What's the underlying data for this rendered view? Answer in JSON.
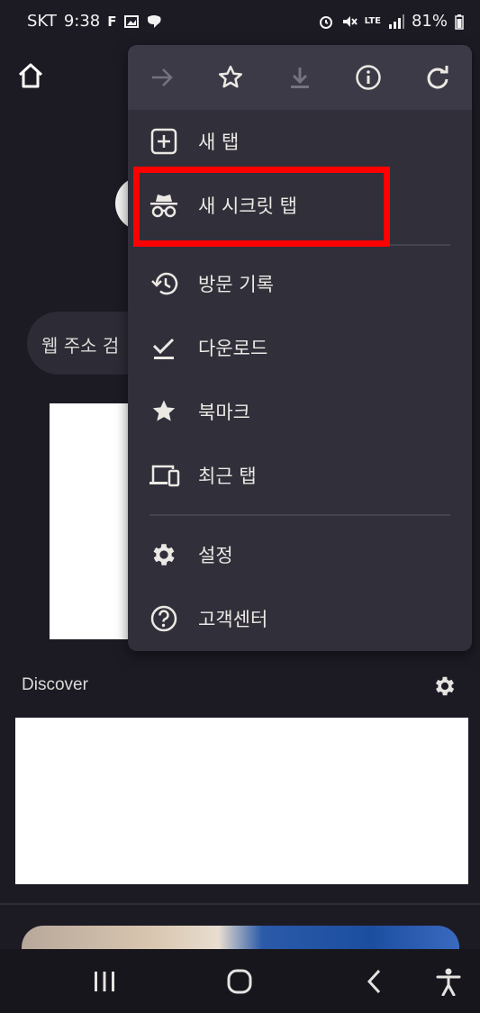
{
  "status_bar": {
    "carrier": "SKT",
    "time": "9:38",
    "network": "LTE",
    "battery": "81%"
  },
  "page": {
    "search_placeholder": "웹 주소 검",
    "discover_label": "Discover"
  },
  "menu": {
    "toolbar_icons": [
      "forward-icon",
      "bookmark-star-icon",
      "download-icon",
      "info-icon",
      "refresh-icon"
    ],
    "items": [
      {
        "label": "새 탭",
        "icon": "new-tab-icon"
      },
      {
        "label": "새 시크릿 탭",
        "icon": "incognito-icon"
      },
      {
        "label": "방문 기록",
        "icon": "history-icon"
      },
      {
        "label": "다운로드",
        "icon": "downloads-icon"
      },
      {
        "label": "북마크",
        "icon": "bookmarks-icon"
      },
      {
        "label": "최근 탭",
        "icon": "recent-tabs-icon"
      },
      {
        "label": "설정",
        "icon": "settings-icon"
      },
      {
        "label": "고객센터",
        "icon": "help-icon"
      }
    ]
  },
  "colors": {
    "background": "#1c1b24",
    "menu_background": "#302f3a",
    "menu_toolbar": "#3b3a46",
    "highlight": "#ff0000"
  }
}
